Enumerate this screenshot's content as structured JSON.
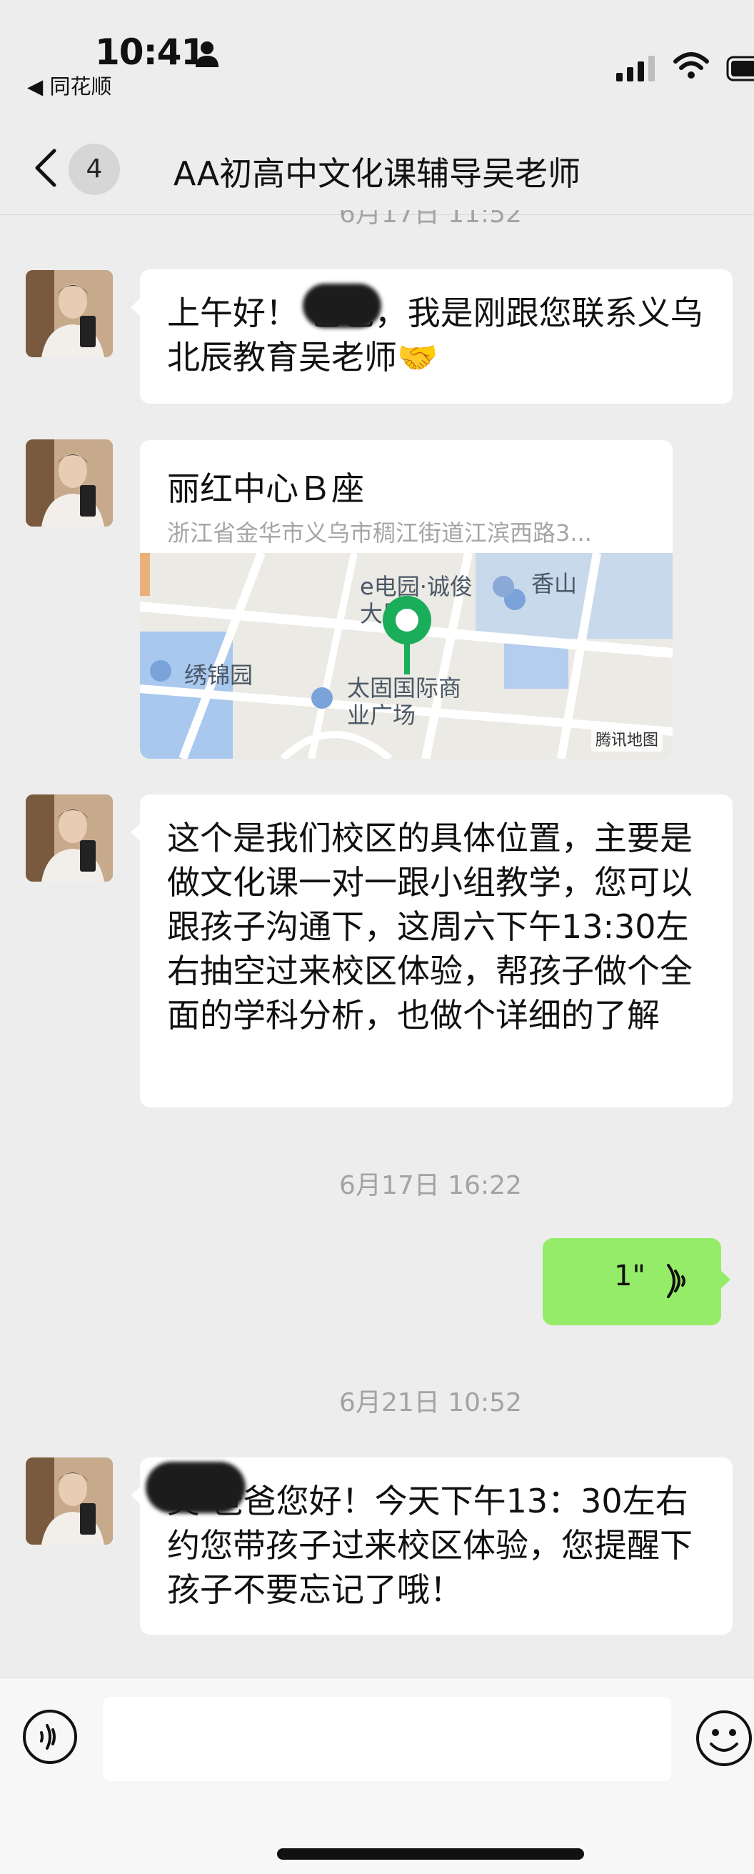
{
  "status_bar": {
    "time": "10:41",
    "back_app": "◀ 同花顺"
  },
  "nav": {
    "unread_count": "4",
    "title": "AA初高中文化课辅导吴老师"
  },
  "chat": {
    "cut_timestamp": "6月17日 11:52",
    "messages": [
      {
        "sender": "teacher",
        "text": "上午好！   爸爸，我是刚跟您联系义乌北辰教育吴老师🤝"
      },
      {
        "sender": "teacher",
        "type": "location",
        "place": "丽红中心Ｂ座",
        "address": "浙江省金华市义乌市稠江街道江滨西路3...",
        "map_labels": [
          "e电园·诚俊大厦",
          "香山",
          "绣锦园",
          "太固国际商业广场"
        ],
        "map_credit": "腾讯地图"
      },
      {
        "sender": "teacher",
        "text": "这个是我们校区的具体位置，主要是做文化课一对一跟小组教学，您可以跟孩子沟通下，这周六下午13:30左右抽空过来校区体验，帮孩子做个全面的学科分析，也做个详细的了解"
      },
      {
        "type": "timestamp",
        "text": "6月17日 16:22"
      },
      {
        "sender": "me",
        "type": "voice",
        "duration": "1\""
      },
      {
        "type": "timestamp",
        "text": "6月21日 10:52"
      },
      {
        "sender": "teacher",
        "text": "奕   爸爸您好！今天下午13：30左右约您带孩子过来校区体验，您提醒下孩子不要忘记了哦！"
      }
    ]
  },
  "colors": {
    "background": "#ededed",
    "bubble_in": "#ffffff",
    "bubble_out": "#95ec69",
    "timestamp": "#a3a3a3",
    "pin": "#1aad5a"
  },
  "icons": [
    "person-icon",
    "signal-icon",
    "wifi-icon",
    "battery-icon",
    "back-chevron-icon",
    "voice-wave-icon",
    "voice-input-icon",
    "emoji-icon",
    "map-pin-icon"
  ]
}
